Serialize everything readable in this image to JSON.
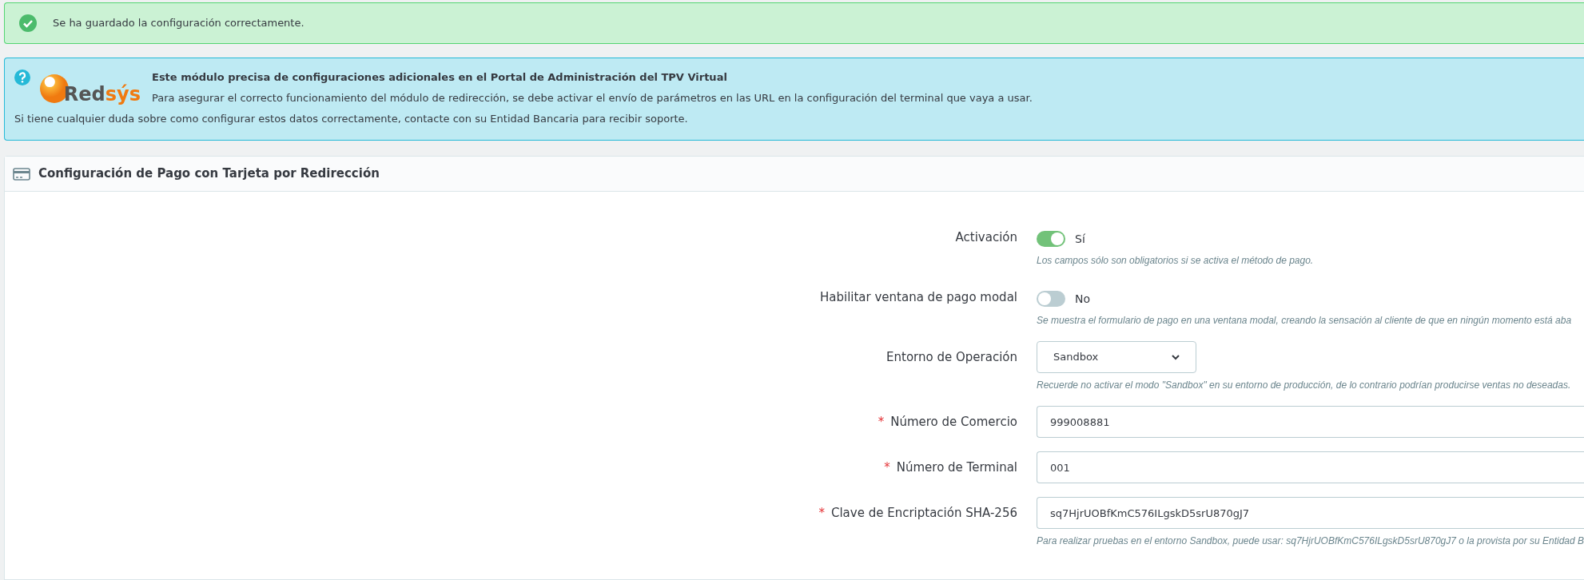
{
  "success_alert": {
    "text": "Se ha guardado la configuración correctamente."
  },
  "info_alert": {
    "logo_text": "Red",
    "logo_accent": "sýs",
    "heading": "Este módulo precisa de configuraciones adicionales en el Portal de Administración del TPV Virtual",
    "line_1": "Para asegurar el correcto funcionamiento del módulo de redirección, se debe activar el envío de parámetros en las URL en la configuración del terminal que vaya a usar.",
    "line_2": "Si tiene cualquier duda sobre como configurar estos datos correctamente, contacte con su Entidad Bancaria para recibir soporte."
  },
  "panel": {
    "title": "Configuración de Pago con Tarjeta por Redirección",
    "required_mark": "*",
    "fields": [
      {
        "kind": "toggle",
        "label": "Activación",
        "required": false,
        "on": true,
        "value": "Sí",
        "help": "Los campos sólo son obligatorios si se activa el método de pago."
      },
      {
        "kind": "toggle",
        "label": "Habilitar ventana de pago modal",
        "required": false,
        "on": false,
        "value": "No",
        "help": "Se muestra el formulario de pago en una ventana modal, creando la sensación al cliente de que en ningún momento está aba"
      },
      {
        "kind": "select",
        "label": "Entorno de Operación",
        "required": false,
        "value": "Sandbox",
        "help": "Recuerde no activar el modo \"Sandbox\" en su entorno de producción, de lo contrario podrían producirse ventas no deseadas."
      },
      {
        "kind": "text",
        "label": "Número de Comercio",
        "required": true,
        "value": "999008881"
      },
      {
        "kind": "text",
        "label": "Número de Terminal",
        "required": true,
        "value": "001"
      },
      {
        "kind": "text",
        "label": "Clave de Encriptación SHA-256",
        "required": true,
        "value": "sq7HjrUOBfKmC576ILgskD5srU870gJ7",
        "help": "Para realizar pruebas en el entorno Sandbox, puede usar: sq7HjrUOBfKmC576ILgskD5srU870gJ7 o la provista por su Entidad B"
      }
    ]
  }
}
